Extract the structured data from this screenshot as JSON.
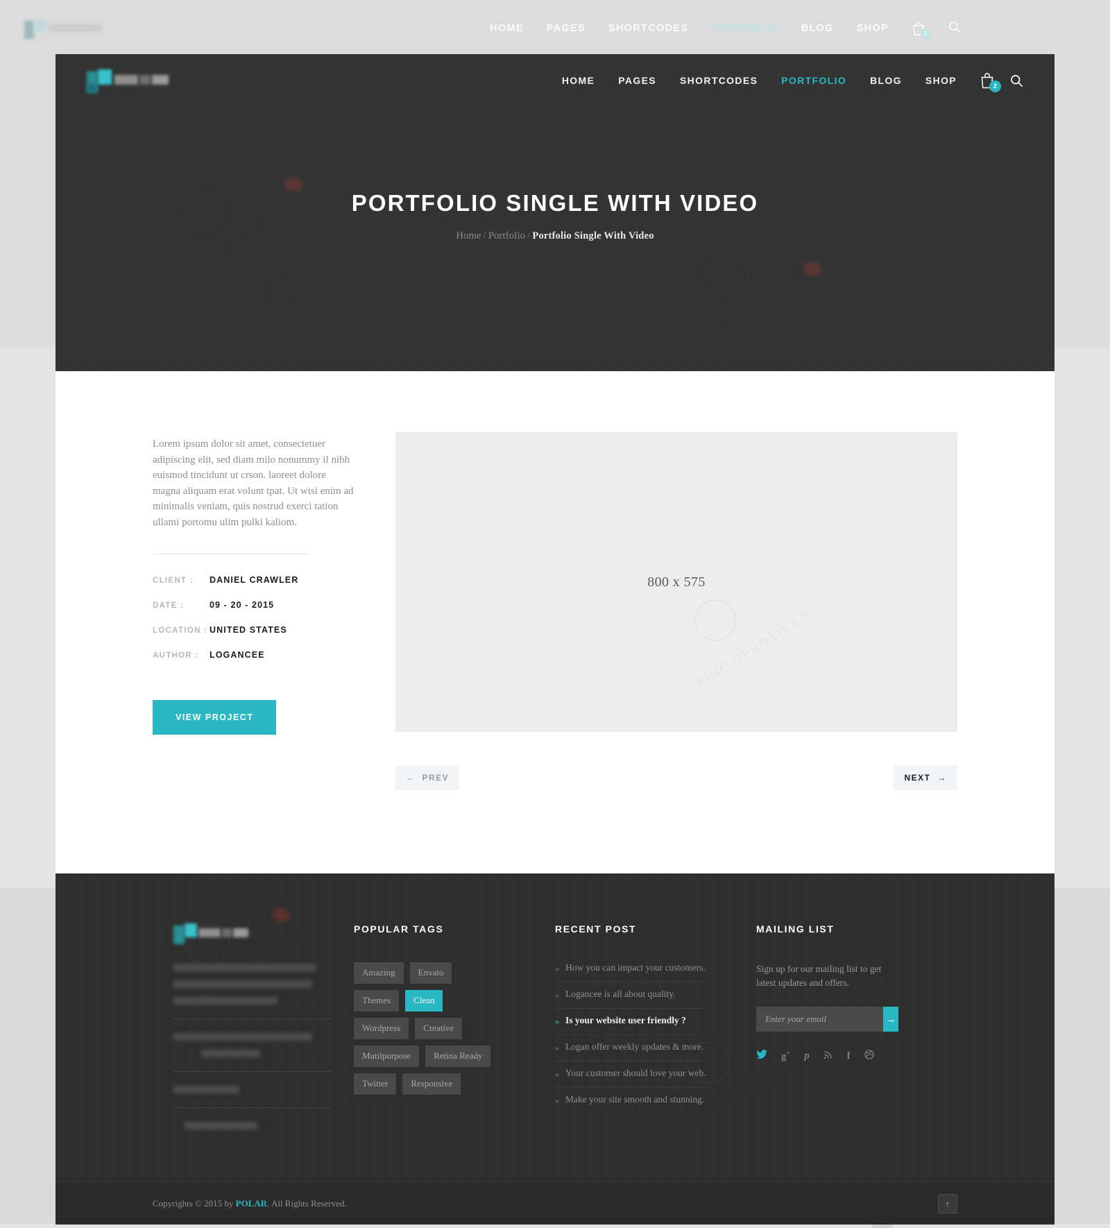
{
  "underlay": {
    "nav": [
      {
        "label": "HOME",
        "active": false
      },
      {
        "label": "PAGES",
        "active": false
      },
      {
        "label": "SHORTCODES",
        "active": false
      },
      {
        "label": "PORTFOLIO",
        "active": true
      },
      {
        "label": "BLOG",
        "active": false
      },
      {
        "label": "SHOP",
        "active": false
      }
    ],
    "cart_count": "2",
    "copyright_pre": "Copyrights © 2015 by ",
    "copyright_brand": "POLAR",
    "copyright_post": ". All Rights Reserved."
  },
  "header": {
    "nav": [
      {
        "label": "HOME",
        "active": false
      },
      {
        "label": "PAGES",
        "active": false
      },
      {
        "label": "SHORTCODES",
        "active": false
      },
      {
        "label": "PORTFOLIO",
        "active": true
      },
      {
        "label": "BLOG",
        "active": false
      },
      {
        "label": "SHOP",
        "active": false
      }
    ],
    "cart_count": "2",
    "cart_icon": "shopping-bag-icon",
    "search_icon": "search-icon"
  },
  "hero": {
    "title": "PORTFOLIO SINGLE WITH VIDEO",
    "breadcrumb": {
      "home": "Home",
      "section": "Portfolio",
      "current": "Portfolio Single With Video",
      "separator": "/"
    }
  },
  "project": {
    "description": "Lorem ipsum dolor sit amet, consectetuer adipiscing elit, sed diam milo nonummy il nibh euismod tincidunt ut crson.\nlaoreet dolore magna aliquam erat volunt tpat. Ut wisi enim ad minimalis veniam, quis nostrud exerci tation ullami portomu ulim pulki kaliom.",
    "meta": [
      {
        "label": "CLIENT :",
        "value": "DANIEL CRAWLER"
      },
      {
        "label": "DATE :",
        "value": "09 - 20 - 2015"
      },
      {
        "label": "LOCATION :",
        "value": "UNITED STATES"
      },
      {
        "label": "AUTHOR :",
        "value": "LOGANCEE"
      }
    ],
    "cta": "VIEW PROJECT",
    "media_placeholder": "800 x 575",
    "pager": {
      "prev": "PREV",
      "prev_icon": "arrow-left-icon",
      "next": "NEXT",
      "next_icon": "arrow-right-icon"
    }
  },
  "footer": {
    "tags_title": "POPULAR TAGS",
    "tags": [
      {
        "label": "Amazing",
        "active": false
      },
      {
        "label": "Envato",
        "active": false
      },
      {
        "label": "Themes",
        "active": false
      },
      {
        "label": "Clean",
        "active": true
      },
      {
        "label": "Wordpress",
        "active": false
      },
      {
        "label": "Creative",
        "active": false
      },
      {
        "label": "Mutilpurpose",
        "active": false
      },
      {
        "label": "Retina Ready",
        "active": false
      },
      {
        "label": "Twitter",
        "active": false
      },
      {
        "label": "Responsive",
        "active": false
      }
    ],
    "recent_title": "RECENT POST",
    "recent_posts": [
      {
        "label": "How you can impact your customers.",
        "active": false
      },
      {
        "label": "Logancee is all about quality.",
        "active": false
      },
      {
        "label": "Is your website user friendly ?",
        "active": true
      },
      {
        "label": "Logan offer weekly updates & more.",
        "active": false
      },
      {
        "label": "Your customer should love your web.",
        "active": false
      },
      {
        "label": "Make your site smooth and stunning.",
        "active": false
      }
    ],
    "mailing_title": "MAILING LIST",
    "mailing_text": "Sign up for our mailing list to get latest updates and offers.",
    "mailing_placeholder": "Enter your email",
    "mailing_value": "",
    "mailing_submit_icon": "arrow-right-icon",
    "socials": [
      {
        "name": "twitter-icon",
        "glyph": "t",
        "active": true
      },
      {
        "name": "google-plus-icon",
        "glyph": "g+",
        "active": false
      },
      {
        "name": "pinterest-icon",
        "glyph": "p",
        "active": false
      },
      {
        "name": "rss-icon",
        "glyph": "rss",
        "active": false
      },
      {
        "name": "facebook-icon",
        "glyph": "f",
        "active": false
      },
      {
        "name": "dribbble-icon",
        "glyph": "d",
        "active": false
      }
    ],
    "copyright_pre": "Copyrights © 2015 by ",
    "copyright_brand": "POLAR",
    "copyright_post": ". All Rights Reserved.",
    "to_top_icon": "arrow-up-icon",
    "bullet": "»"
  },
  "colors": {
    "accent": "#2ab7c4",
    "hero_bg": "#333333",
    "footer_bg": "#2e2e2e",
    "footer_bottom_bg": "#2b2b2b",
    "media_bg": "#ededed"
  },
  "watermark": {
    "text": "PHOTOPHOTO.CN"
  }
}
